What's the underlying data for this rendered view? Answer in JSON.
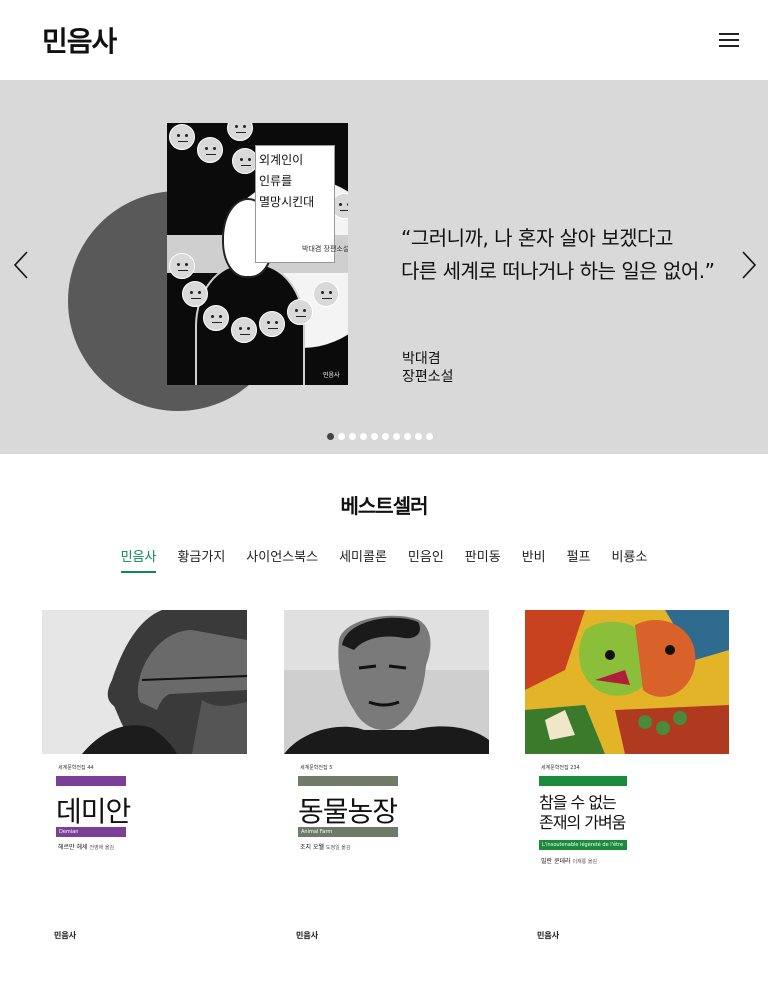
{
  "header": {
    "logo": "민음사",
    "menu_icon": "hamburger-icon"
  },
  "hero": {
    "book": {
      "title_lines": [
        "외계인이",
        "인류를",
        "멸망시킨대"
      ],
      "author_line": "박대겸 장편소설",
      "publisher": "민음사"
    },
    "quote_line1": "“그러니까, 나 혼자 살아 보겠다고",
    "quote_line2": "다른 세계로 떠나거나 하는 일은 없어.”",
    "author_name": "박대겸",
    "author_sub": "장편소설",
    "prev_icon": "chevron-left-icon",
    "next_icon": "chevron-right-icon",
    "slide_count": 10,
    "active_slide": 1
  },
  "bestseller": {
    "title": "베스트셀러",
    "tabs": [
      "민음사",
      "황금가지",
      "사이언스북스",
      "세미콜론",
      "민음인",
      "판미동",
      "반비",
      "펄프",
      "비룡소"
    ],
    "active_tab": 0
  },
  "books": [
    {
      "series": "세계문학전집 44",
      "title": "데미안",
      "original": "Demian",
      "author": "헤르만 헤세",
      "translator": "전영애 옮김",
      "publisher": "민음사",
      "accent": "#7b3f98"
    },
    {
      "series": "세계문학전집 5",
      "title": "동물농장",
      "original": "Animal Farm",
      "author": "조지 오웰",
      "translator": "도정일 옮김",
      "publisher": "민음사",
      "accent": "#6f7a68"
    },
    {
      "series": "세계문학전집 234",
      "title_line1": "참을 수 없는",
      "title_line2": "존재의 가벼움",
      "original": "L'insoutenable légèreté de l'être",
      "author": "밀란 쿤데라",
      "translator": "이재룡 옮김",
      "publisher": "민음사",
      "accent": "#1a8a3c"
    }
  ]
}
